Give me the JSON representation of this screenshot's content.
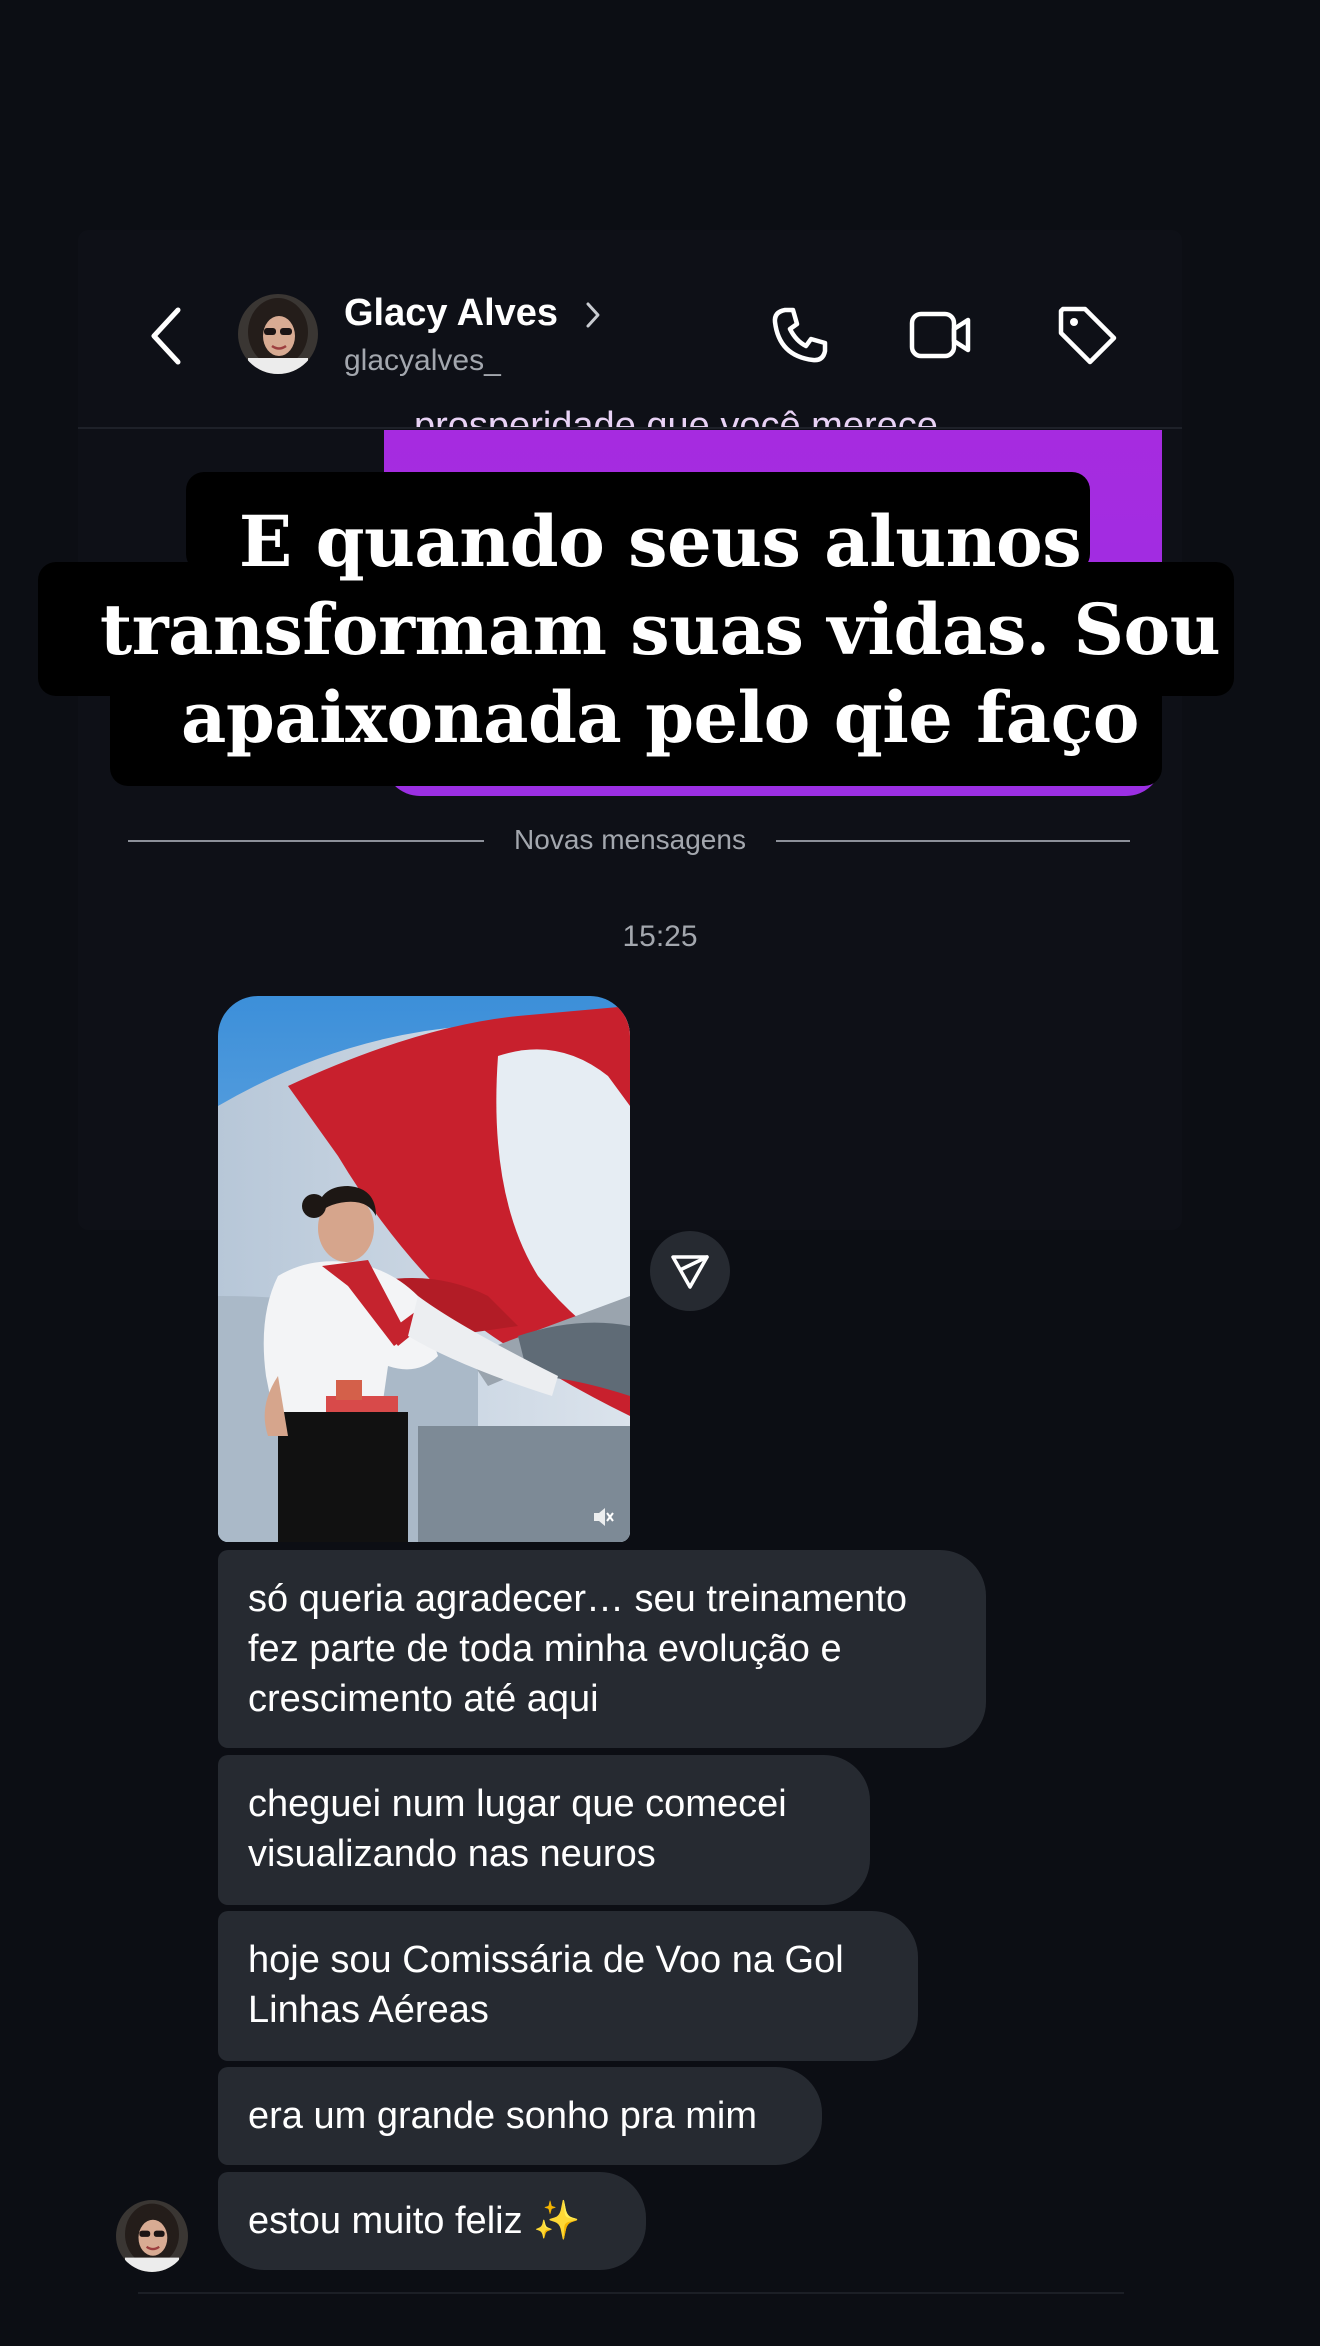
{
  "header": {
    "contact_name": "Glacy Alves",
    "contact_handle": "glacyalves_",
    "icons": [
      "back-chevron-icon",
      "name-chevron-icon",
      "phone-icon",
      "video-camera-icon",
      "tag-icon"
    ]
  },
  "sent_message": {
    "visible_text": "prosperidade que você merece."
  },
  "caption": {
    "line1": "E quando seus alunos",
    "line2": "transformam suas vidas. Sou",
    "line3": "apaixonada pelo qie faço"
  },
  "separator": {
    "label": "Novas mensagens"
  },
  "timestamp": "15:25",
  "received_messages": [
    {
      "line1": "só queria agradecer… seu treinamento",
      "line2": "fez parte de toda minha evolução e",
      "line3": "crescimento até aqui"
    },
    {
      "line1": "cheguei num lugar que comecei",
      "line2": "visualizando nas neuros"
    },
    {
      "line1": "hoje sou Comissária de Voo na Gol",
      "line2": "Linhas Aéreas"
    },
    {
      "line1": "era um grande sonho pra mim"
    },
    {
      "line1": "estou muito feliz ✨"
    }
  ],
  "colors": {
    "background": "#0c0e14",
    "received_bubble": "#262a31",
    "sent_bubble": "#a62be0",
    "secondary_text": "#a3a7ae"
  }
}
